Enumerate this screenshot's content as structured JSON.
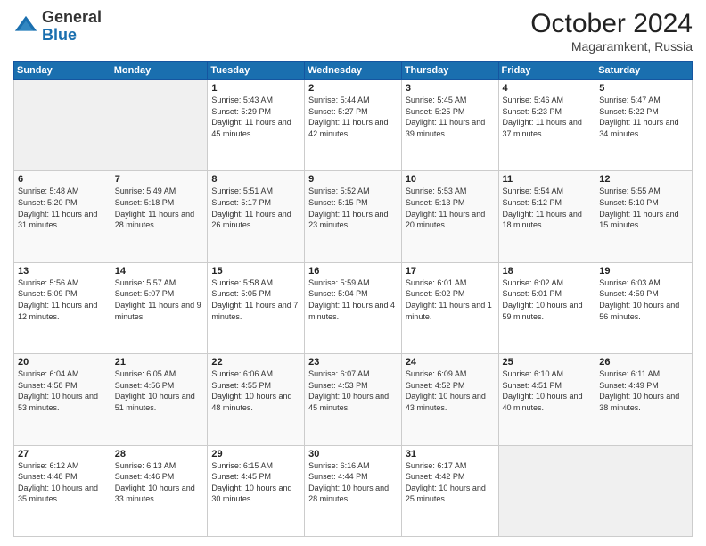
{
  "header": {
    "logo": {
      "line1": "General",
      "line2": "Blue"
    },
    "title": "October 2024",
    "location": "Magaramkent, Russia"
  },
  "weekdays": [
    "Sunday",
    "Monday",
    "Tuesday",
    "Wednesday",
    "Thursday",
    "Friday",
    "Saturday"
  ],
  "weeks": [
    [
      {
        "day": "",
        "info": ""
      },
      {
        "day": "",
        "info": ""
      },
      {
        "day": "1",
        "info": "Sunrise: 5:43 AM\nSunset: 5:29 PM\nDaylight: 11 hours and 45 minutes."
      },
      {
        "day": "2",
        "info": "Sunrise: 5:44 AM\nSunset: 5:27 PM\nDaylight: 11 hours and 42 minutes."
      },
      {
        "day": "3",
        "info": "Sunrise: 5:45 AM\nSunset: 5:25 PM\nDaylight: 11 hours and 39 minutes."
      },
      {
        "day": "4",
        "info": "Sunrise: 5:46 AM\nSunset: 5:23 PM\nDaylight: 11 hours and 37 minutes."
      },
      {
        "day": "5",
        "info": "Sunrise: 5:47 AM\nSunset: 5:22 PM\nDaylight: 11 hours and 34 minutes."
      }
    ],
    [
      {
        "day": "6",
        "info": "Sunrise: 5:48 AM\nSunset: 5:20 PM\nDaylight: 11 hours and 31 minutes."
      },
      {
        "day": "7",
        "info": "Sunrise: 5:49 AM\nSunset: 5:18 PM\nDaylight: 11 hours and 28 minutes."
      },
      {
        "day": "8",
        "info": "Sunrise: 5:51 AM\nSunset: 5:17 PM\nDaylight: 11 hours and 26 minutes."
      },
      {
        "day": "9",
        "info": "Sunrise: 5:52 AM\nSunset: 5:15 PM\nDaylight: 11 hours and 23 minutes."
      },
      {
        "day": "10",
        "info": "Sunrise: 5:53 AM\nSunset: 5:13 PM\nDaylight: 11 hours and 20 minutes."
      },
      {
        "day": "11",
        "info": "Sunrise: 5:54 AM\nSunset: 5:12 PM\nDaylight: 11 hours and 18 minutes."
      },
      {
        "day": "12",
        "info": "Sunrise: 5:55 AM\nSunset: 5:10 PM\nDaylight: 11 hours and 15 minutes."
      }
    ],
    [
      {
        "day": "13",
        "info": "Sunrise: 5:56 AM\nSunset: 5:09 PM\nDaylight: 11 hours and 12 minutes."
      },
      {
        "day": "14",
        "info": "Sunrise: 5:57 AM\nSunset: 5:07 PM\nDaylight: 11 hours and 9 minutes."
      },
      {
        "day": "15",
        "info": "Sunrise: 5:58 AM\nSunset: 5:05 PM\nDaylight: 11 hours and 7 minutes."
      },
      {
        "day": "16",
        "info": "Sunrise: 5:59 AM\nSunset: 5:04 PM\nDaylight: 11 hours and 4 minutes."
      },
      {
        "day": "17",
        "info": "Sunrise: 6:01 AM\nSunset: 5:02 PM\nDaylight: 11 hours and 1 minute."
      },
      {
        "day": "18",
        "info": "Sunrise: 6:02 AM\nSunset: 5:01 PM\nDaylight: 10 hours and 59 minutes."
      },
      {
        "day": "19",
        "info": "Sunrise: 6:03 AM\nSunset: 4:59 PM\nDaylight: 10 hours and 56 minutes."
      }
    ],
    [
      {
        "day": "20",
        "info": "Sunrise: 6:04 AM\nSunset: 4:58 PM\nDaylight: 10 hours and 53 minutes."
      },
      {
        "day": "21",
        "info": "Sunrise: 6:05 AM\nSunset: 4:56 PM\nDaylight: 10 hours and 51 minutes."
      },
      {
        "day": "22",
        "info": "Sunrise: 6:06 AM\nSunset: 4:55 PM\nDaylight: 10 hours and 48 minutes."
      },
      {
        "day": "23",
        "info": "Sunrise: 6:07 AM\nSunset: 4:53 PM\nDaylight: 10 hours and 45 minutes."
      },
      {
        "day": "24",
        "info": "Sunrise: 6:09 AM\nSunset: 4:52 PM\nDaylight: 10 hours and 43 minutes."
      },
      {
        "day": "25",
        "info": "Sunrise: 6:10 AM\nSunset: 4:51 PM\nDaylight: 10 hours and 40 minutes."
      },
      {
        "day": "26",
        "info": "Sunrise: 6:11 AM\nSunset: 4:49 PM\nDaylight: 10 hours and 38 minutes."
      }
    ],
    [
      {
        "day": "27",
        "info": "Sunrise: 6:12 AM\nSunset: 4:48 PM\nDaylight: 10 hours and 35 minutes."
      },
      {
        "day": "28",
        "info": "Sunrise: 6:13 AM\nSunset: 4:46 PM\nDaylight: 10 hours and 33 minutes."
      },
      {
        "day": "29",
        "info": "Sunrise: 6:15 AM\nSunset: 4:45 PM\nDaylight: 10 hours and 30 minutes."
      },
      {
        "day": "30",
        "info": "Sunrise: 6:16 AM\nSunset: 4:44 PM\nDaylight: 10 hours and 28 minutes."
      },
      {
        "day": "31",
        "info": "Sunrise: 6:17 AM\nSunset: 4:42 PM\nDaylight: 10 hours and 25 minutes."
      },
      {
        "day": "",
        "info": ""
      },
      {
        "day": "",
        "info": ""
      }
    ]
  ]
}
